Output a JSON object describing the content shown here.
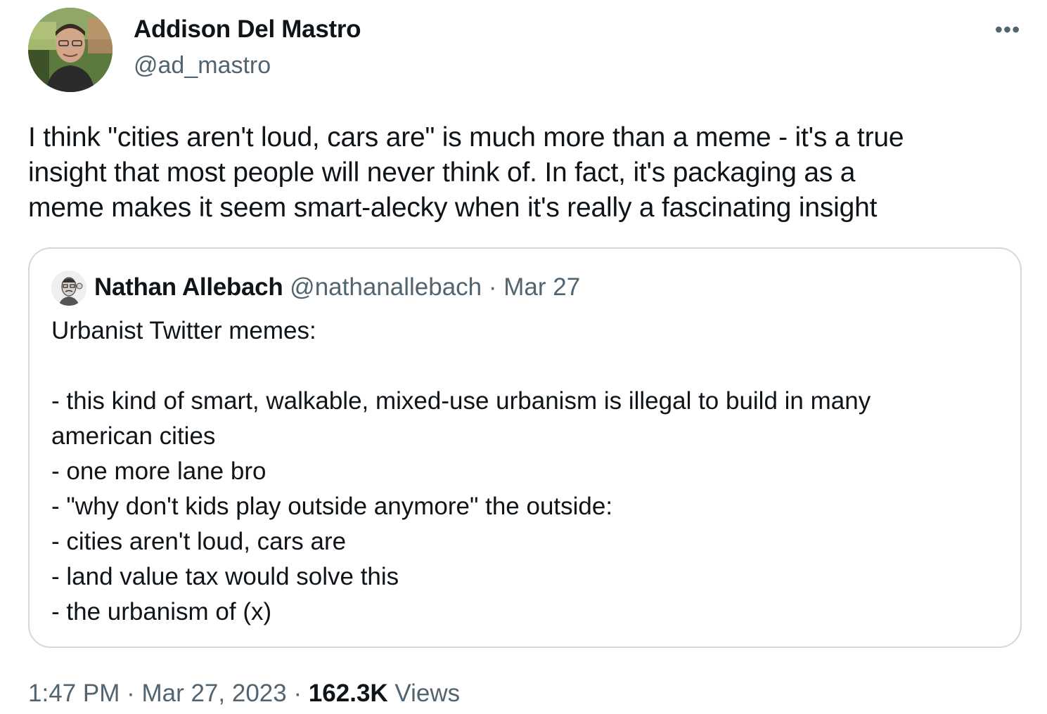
{
  "author": {
    "name": "Addison Del Mastro",
    "handle": "@ad_mastro",
    "avatar_icon": "profile-photo"
  },
  "more_icon": "ellipsis-icon",
  "more_label": "•••",
  "tweet": {
    "lines": [
      "I think \"cities aren't loud, cars are\" is much more than a meme - it's a true",
      "insight that most people will never think of. In fact, it's packaging as a",
      "meme makes it seem smart-alecky when it's really a fascinating insight"
    ]
  },
  "quote": {
    "name": "Nathan Allebach",
    "handle": "@nathanallebach",
    "separator": " · ",
    "date": "Mar 27",
    "lines": [
      "Urbanist Twitter memes:",
      "",
      "- this kind of smart, walkable, mixed-use urbanism is illegal to build in many",
      "american cities",
      "- one more lane bro",
      "- \"why don't kids play outside anymore\" the outside:",
      "- cities aren't loud, cars are",
      "- land value tax would solve this",
      "- the urbanism of (x)"
    ]
  },
  "meta": {
    "time": "1:47 PM",
    "separator": " · ",
    "date": "Mar 27, 2023",
    "views_count": "162.3K",
    "views_label": " Views"
  },
  "colors": {
    "text": "#0f1419",
    "secondary": "#536471",
    "border": "#cfd9de"
  }
}
